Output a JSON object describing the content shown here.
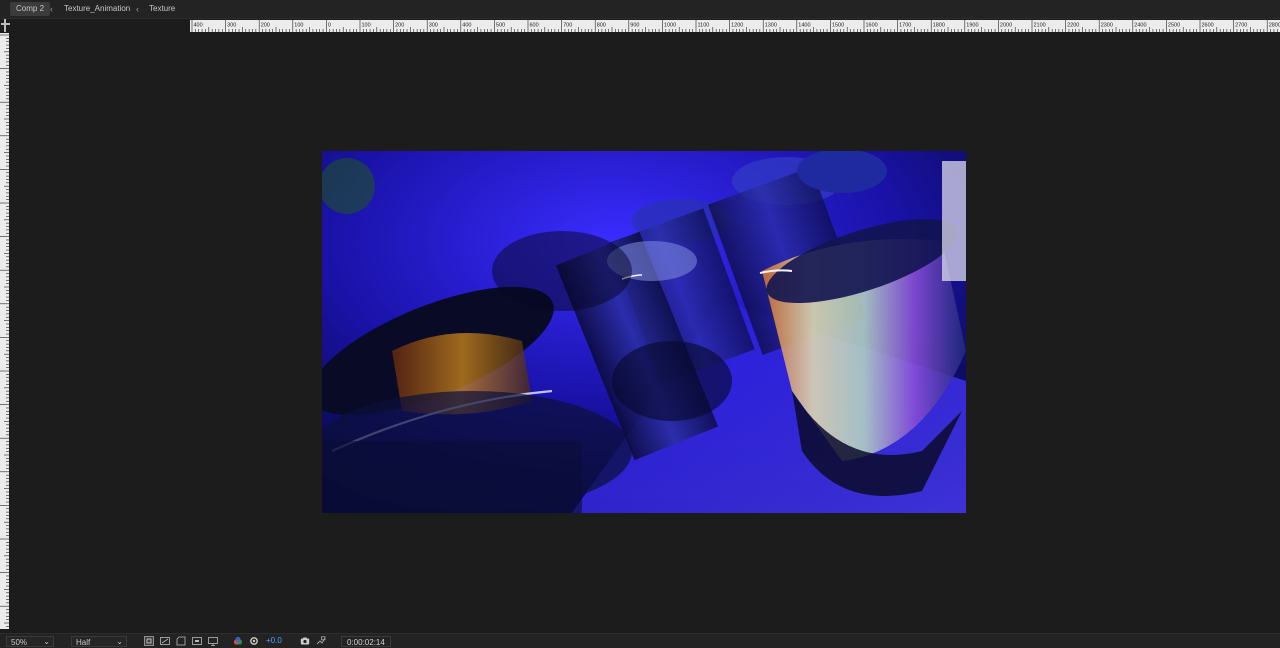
{
  "breadcrumb": {
    "items": [
      {
        "label": "Comp 2",
        "active": true
      },
      {
        "label": "Texture_Animation",
        "active": false
      },
      {
        "label": "Texture",
        "active": false
      }
    ],
    "separator_icon": "chevron-left-icon"
  },
  "ruler": {
    "horizontal_labels": [
      "400",
      "300",
      "200",
      "100",
      "0",
      "100",
      "200",
      "300",
      "400",
      "500",
      "600",
      "700",
      "800",
      "900",
      "1000",
      "1100",
      "1200",
      "1300",
      "1400",
      "1500",
      "1600",
      "1700",
      "1800",
      "1900",
      "2000",
      "2100",
      "2200",
      "2300",
      "2400",
      "2500",
      "2600",
      "2700",
      "2800"
    ]
  },
  "viewer": {
    "frame_description_icon": "render-frame",
    "background_color": "#1c1c1c",
    "frame_accent_color": "#2a1fd6"
  },
  "toolbar": {
    "magnification": "50%",
    "resolution": "Half",
    "exposure": "+0.0",
    "timecode": "0:00:02:14",
    "icons": [
      "region-of-interest-icon",
      "transparency-grid-icon",
      "mask-path-icon",
      "guides-icon",
      "channels-icon",
      "color-management-icon",
      "snapshot-icon",
      "show-snapshot-icon"
    ]
  }
}
